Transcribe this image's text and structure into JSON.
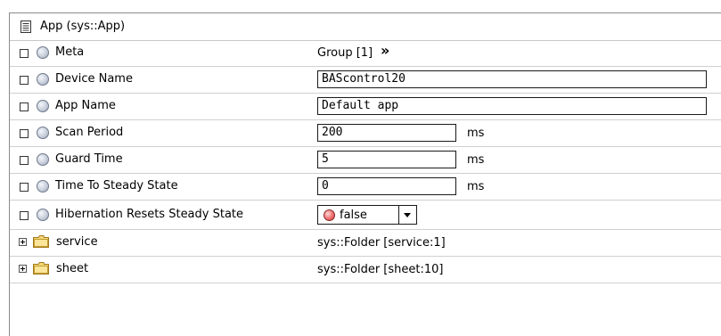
{
  "header": {
    "title": "App  (sys::App)",
    "icon": "document-icon"
  },
  "rows": {
    "meta": {
      "label": "Meta",
      "value": "Group [1]",
      "chevron": "»"
    },
    "device_name": {
      "label": "Device Name",
      "value": "BAScontrol20"
    },
    "app_name": {
      "label": "App Name",
      "value": "Default app"
    },
    "scan_period": {
      "label": "Scan Period",
      "value": "200",
      "unit": "ms"
    },
    "guard_time": {
      "label": "Guard Time",
      "value": "5",
      "unit": "ms"
    },
    "time_to_steady": {
      "label": "Time To Steady State",
      "value": "0",
      "unit": "ms"
    },
    "hibernation": {
      "label": "Hibernation Resets Steady State",
      "value": "false",
      "status_color": "#e05050"
    }
  },
  "folders": [
    {
      "label": "service",
      "value": "sys::Folder [service:1]",
      "icon": "folder-icon"
    },
    {
      "label": "sheet",
      "value": "sys::Folder [sheet:10]",
      "icon": "folder-icon"
    }
  ]
}
